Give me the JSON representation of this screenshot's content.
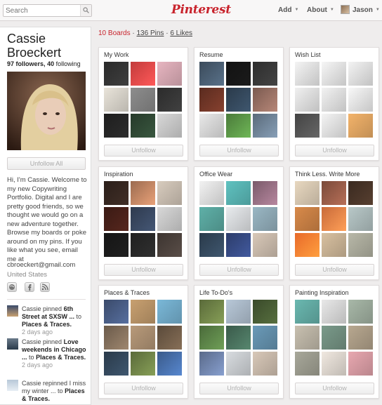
{
  "header": {
    "search_placeholder": "Search",
    "logo": "Pinterest",
    "nav": [
      {
        "label": "Add"
      },
      {
        "label": "About"
      },
      {
        "label": "Jason"
      }
    ]
  },
  "profile": {
    "name": "Cassie Broeckert",
    "followers": "97",
    "followers_label": "followers,",
    "following": "40",
    "following_label": "following",
    "unfollow_all": "Unfollow All",
    "bio": "Hi, I'm Cassie. Welcome to my new Copywriting Portfolio. Digital and I are pretty good friends, so we thought we would go on a new adventure together. Browse my boards or poke around on my pins. If you like what you see, email me at",
    "email": "cbroeckert@gmail.com",
    "location": "United States"
  },
  "activity": [
    {
      "user": "Cassie",
      "action": "pinned",
      "pin": "6th Street at SXSW ...",
      "to": "to",
      "board": "Places & Traces.",
      "ago": "2 days ago"
    },
    {
      "user": "Cassie",
      "action": "pinned",
      "pin": "Love weekends in Chicago ...",
      "to": "to",
      "board": "Places & Traces.",
      "ago": "2 days ago"
    },
    {
      "user": "Cassie",
      "action": "repinned",
      "pin": "I miss my winter ...",
      "to": "to",
      "board": "Places & Traces.",
      "ago": ""
    }
  ],
  "tabs": {
    "boards": "10 Boards",
    "sep1": "·",
    "pins": "136 Pins",
    "sep2": "·",
    "likes": "6 Likes"
  },
  "boards": [
    {
      "title": "My Work",
      "button": "Unfollow",
      "colors": [
        "#2a2a2a",
        "#c23b3b",
        "#e7b5c0",
        "#e9e4da",
        "#8d8d8d",
        "#2b2b2b",
        "#1e1e1e",
        "#263a2a",
        "#d8d8d8"
      ]
    },
    {
      "title": "Resume",
      "button": "Unfollow",
      "colors": [
        "#3b4b5b",
        "#121212",
        "#2d2d2d",
        "#5a2b1f",
        "#2a3a4a",
        "#7a5a50",
        "#e8e8e8",
        "#4a7a3a",
        "#5a6a7a"
      ]
    },
    {
      "title": "Wish List",
      "button": "Unfollow",
      "colors": [
        "#f4f4f4",
        "#f6f6f6",
        "#f3f3f3",
        "#f0f0f0",
        "#f2f2f2",
        "#f8f8f8",
        "#444444",
        "#f4f4f4",
        "#f3b36a"
      ]
    },
    {
      "title": "Inspiration",
      "button": "Unfollow",
      "colors": [
        "#2b1f1a",
        "#9b6b50",
        "#d8ccbe",
        "#3a1a14",
        "#2e3a4e",
        "#d8d8d8",
        "#151515",
        "#202020",
        "#3c3430"
      ]
    },
    {
      "title": "Office Wear",
      "button": "Unfollow",
      "colors": [
        "#f2f2f2",
        "#5fc2c0",
        "#7a5a6a",
        "#5fb0a8",
        "#e8ebee",
        "#9ab7c4",
        "#2a3a4a",
        "#2c3c6a",
        "#d8c8b8"
      ]
    },
    {
      "title": "Think Less. Write More",
      "button": "Unfollow",
      "colors": [
        "#e8d8c0",
        "#7a4a3a",
        "#3a2a20",
        "#d88a4a",
        "#c86a3a",
        "#b8c8c8",
        "#e86a2a",
        "#d8c0a0",
        "#b8b8a8"
      ]
    },
    {
      "title": "Places & Traces",
      "button": "Unfollow",
      "colors": [
        "#3a4a6a",
        "#c8a070",
        "#7ab8d8",
        "#6a5a4a",
        "#b89a7a",
        "#5a4a3a",
        "#2a3a4a",
        "#5a6a3a",
        "#3a5a8a"
      ]
    },
    {
      "title": "Life To-Do's",
      "button": "Unfollow",
      "colors": [
        "#5a6a3a",
        "#b8c8d8",
        "#3a4a2a",
        "#4a6a3a",
        "#3a5a4a",
        "#6a9ab8",
        "#5a6a8a",
        "#d8dce0",
        "#d8c8b8"
      ]
    },
    {
      "title": "Painting Inspiration",
      "button": "Unfollow",
      "colors": [
        "#6ab8b0",
        "#e8e8e8",
        "#a8b8a8",
        "#c8c0b0",
        "#7a9a8a",
        "#b8a890",
        "#a8a89a",
        "#f0e8e0",
        "#e8a8b0"
      ]
    }
  ],
  "colors": {
    "brand": "#c8232c"
  }
}
